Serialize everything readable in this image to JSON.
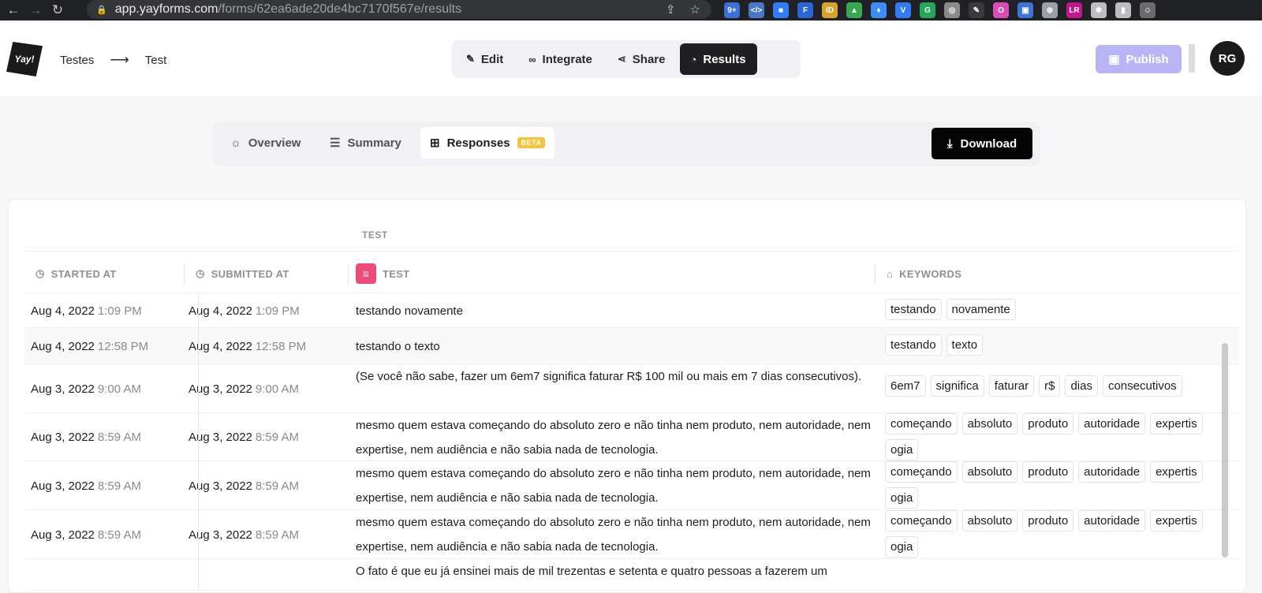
{
  "browser": {
    "url_domain": "app.yayforms.com",
    "url_path": "/forms/62ea6ade20de4bc7170f567e/results",
    "extensions": [
      "9+",
      "</>",
      "■",
      "F",
      "ID",
      "▲",
      "♦",
      "V",
      "G",
      "◎",
      "✎",
      "O",
      "▣",
      "⊕",
      "LR",
      "✱",
      "▮",
      "☺"
    ]
  },
  "header": {
    "logo_text": "Yay!",
    "breadcrumb": [
      "Testes",
      "Test"
    ],
    "breadcrumb_sep": "⟶",
    "tabs": [
      {
        "label": "Edit",
        "icon": "edit-icon"
      },
      {
        "label": "Integrate",
        "icon": "link-icon"
      },
      {
        "label": "Share",
        "icon": "share-icon"
      },
      {
        "label": "Results",
        "icon": "results-icon"
      }
    ],
    "publish_label": "Publish",
    "avatar_initials": "RG"
  },
  "results_nav": {
    "tabs": [
      {
        "label": "Overview",
        "icon": "sun-icon"
      },
      {
        "label": "Summary",
        "icon": "list-icon"
      },
      {
        "label": "Responses",
        "icon": "table-icon",
        "badge": "BETA"
      }
    ],
    "download_label": "Download"
  },
  "table": {
    "group_header": "TEST",
    "columns": {
      "started": "STARTED AT",
      "submitted": "SUBMITTED AT",
      "test": "TEST",
      "keywords": "KEYWORDS"
    },
    "rows": [
      {
        "started_date": "Aug 4, 2022",
        "started_time": "1:09 PM",
        "submitted_date": "Aug 4, 2022",
        "submitted_time": "1:09 PM",
        "answer": "testando novamente",
        "keywords": [
          "testando",
          "novamente"
        ]
      },
      {
        "started_date": "Aug 4, 2022",
        "started_time": "12:58 PM",
        "submitted_date": "Aug 4, 2022",
        "submitted_time": "12:58 PM",
        "answer": "testando o texto",
        "keywords": [
          "testando",
          "texto"
        ]
      },
      {
        "started_date": "Aug 3, 2022",
        "started_time": "9:00 AM",
        "submitted_date": "Aug 3, 2022",
        "submitted_time": "9:00 AM",
        "answer": "(Se você não sabe, fazer um 6em7 significa faturar R$ 100 mil ou mais em 7 dias consecutivos).",
        "keywords": [
          "6em7",
          "significa",
          "faturar",
          "r$",
          "dias",
          "consecutivos"
        ]
      },
      {
        "started_date": "Aug 3, 2022",
        "started_time": "8:59 AM",
        "submitted_date": "Aug 3, 2022",
        "submitted_time": "8:59 AM",
        "answer": "mesmo quem estava começando do absoluto zero e não tinha nem produto, nem autoridade, nem expertise, nem audiência e não sabia nada de tecnologia.",
        "keywords": [
          "começando",
          "absoluto",
          "produto",
          "autoridade",
          "expertis",
          "ogia"
        ]
      },
      {
        "started_date": "Aug 3, 2022",
        "started_time": "8:59 AM",
        "submitted_date": "Aug 3, 2022",
        "submitted_time": "8:59 AM",
        "answer": "mesmo quem estava começando do absoluto zero e não tinha nem produto, nem autoridade, nem expertise, nem audiência e não sabia nada de tecnologia.",
        "keywords": [
          "começando",
          "absoluto",
          "produto",
          "autoridade",
          "expertis",
          "ogia"
        ]
      },
      {
        "started_date": "Aug 3, 2022",
        "started_time": "8:59 AM",
        "submitted_date": "Aug 3, 2022",
        "submitted_time": "8:59 AM",
        "answer": "mesmo quem estava começando do absoluto zero e não tinha nem produto, nem autoridade, nem expertise, nem audiência e não sabia nada de tecnologia.",
        "keywords": [
          "começando",
          "absoluto",
          "produto",
          "autoridade",
          "expertis",
          "ogia"
        ]
      },
      {
        "started_date": "",
        "started_time": "",
        "submitted_date": "",
        "submitted_time": "",
        "answer": "O fato é que eu já ensinei mais de mil trezentas e setenta e quatro pessoas a fazerem um",
        "keywords": []
      }
    ]
  },
  "colors": {
    "accent_dark": "#1f1f22",
    "publish": "#b9b4f5",
    "beta_badge": "#f5c43b",
    "test_badge": "#ee4c78"
  }
}
